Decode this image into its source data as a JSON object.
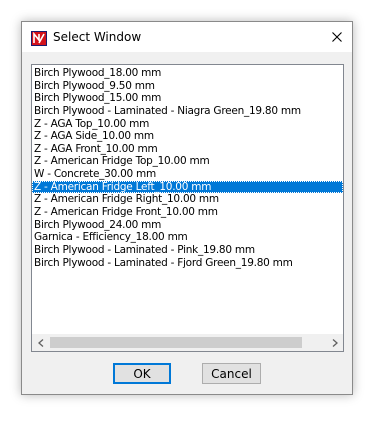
{
  "window": {
    "title": "Select Window",
    "icon": "app-logo-icon",
    "close_icon": "close-icon"
  },
  "list": {
    "items": [
      "Birch Plywood_18.00 mm",
      "Birch Plywood_9.50 mm",
      "Birch Plywood_15.00 mm",
      "Birch Plywood - Laminated - Niagra Green_19.80 mm",
      "Z - AGA Top_10.00 mm",
      "Z - AGA Side_10.00 mm",
      "Z - AGA Front_10.00 mm",
      "Z - American Fridge Top_10.00 mm",
      "W - Concrete_30.00 mm",
      "Z - American Fridge Left_10.00 mm",
      "Z - American Fridge Right_10.00 mm",
      "Z - American Fridge Front_10.00 mm",
      "Birch Plywood_24.00 mm",
      "Garnica - Efficiency_18.00 mm",
      "Birch Plywood - Laminated - Pink_19.80 mm",
      "Birch Plywood - Laminated - Fjord Green_19.80 mm"
    ],
    "selected_item": "Z - American Fridge Left_10.00 mm"
  },
  "buttons": {
    "ok_label": "OK",
    "cancel_label": "Cancel"
  },
  "colors": {
    "selection": "#0078d7",
    "app_icon_red": "#d3121b"
  }
}
